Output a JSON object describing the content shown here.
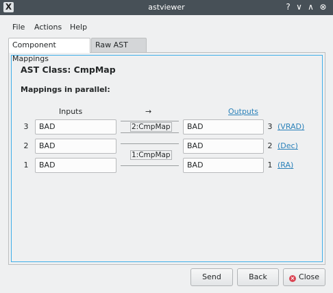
{
  "window": {
    "title": "astviewer",
    "app_icon_glyph": "X",
    "help_glyph": "?",
    "minimize_glyph": "∨",
    "maximize_glyph": "∧",
    "close_glyph": "⊗"
  },
  "menu": {
    "file": "File",
    "actions": "Actions",
    "help": "Help"
  },
  "tabs": [
    {
      "label": "Component Mappings",
      "active": true
    },
    {
      "label": "Raw AST data",
      "active": false
    }
  ],
  "main": {
    "heading": "AST Class: CmpMap",
    "subheading": "Mappings in parallel:",
    "inputs_header": "Inputs",
    "arrow_header": "→",
    "outputs_header": "Outputs",
    "rows": [
      {
        "in_num": "3",
        "input": "BAD",
        "output": "BAD",
        "out_num": "3",
        "out_name": "(VRAD)"
      },
      {
        "in_num": "2",
        "input": "BAD",
        "output": "BAD",
        "out_num": "2",
        "out_name": "(Dec)"
      },
      {
        "in_num": "1",
        "input": "BAD",
        "output": "BAD",
        "out_num": "1",
        "out_name": "(RA)"
      }
    ],
    "mappings": [
      "2:CmpMap",
      "1:CmpMap"
    ]
  },
  "buttons": {
    "send": "Send",
    "back": "Back",
    "close": "Close"
  },
  "colors": {
    "titlebar": "#475057",
    "focus_border": "#3daee9",
    "link": "#2980b9",
    "close_icon": "#da4453"
  }
}
